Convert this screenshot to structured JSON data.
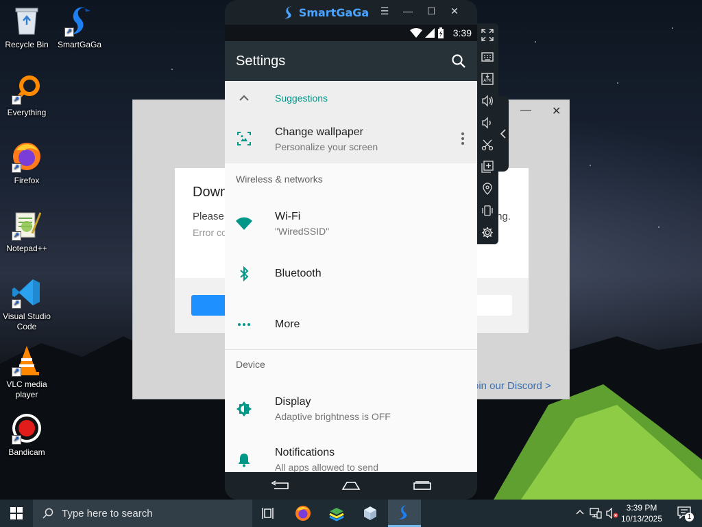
{
  "desktop": {
    "icons": [
      {
        "name": "recycle-bin",
        "label": "Recycle Bin"
      },
      {
        "name": "smartgaga",
        "label": "SmartGaGa"
      },
      {
        "name": "everything",
        "label": "Everything"
      },
      {
        "name": "firefox",
        "label": "Firefox"
      },
      {
        "name": "notepad-plus-plus",
        "label": "Notepad++"
      },
      {
        "name": "visual-studio-code",
        "label": "Visual Studio Code"
      },
      {
        "name": "vlc",
        "label": "VLC media player"
      },
      {
        "name": "bandicam",
        "label": "Bandicam"
      }
    ]
  },
  "background_dialog": {
    "title": "Down",
    "line1": "Please",
    "line1_tail": "ng.",
    "line2": "Error co",
    "discord_link": "oin our Discord >"
  },
  "emulator": {
    "title": "SmartGaGa",
    "controls": {
      "menu": "☰",
      "minimize": "—",
      "maximize": "☐",
      "close": "✕"
    },
    "status_bar": {
      "time": "3:39"
    },
    "app_bar": {
      "title": "Settings"
    },
    "settings": {
      "suggestions_label": "Suggestions",
      "change_wallpaper": {
        "title": "Change wallpaper",
        "subtitle": "Personalize your screen"
      },
      "wireless_section": "Wireless & networks",
      "wifi": {
        "title": "Wi-Fi",
        "subtitle": "\"WiredSSID\""
      },
      "bluetooth": {
        "title": "Bluetooth"
      },
      "more": {
        "title": "More"
      },
      "device_section": "Device",
      "display": {
        "title": "Display",
        "subtitle": "Adaptive brightness is OFF"
      },
      "notifications": {
        "title": "Notifications",
        "subtitle": "All apps allowed to send"
      }
    }
  },
  "taskbar": {
    "search_placeholder": "Type here to search",
    "clock_time": "3:39 PM",
    "clock_date": "10/13/2025",
    "notification_count": "1"
  },
  "colors": {
    "teal_accent": "#009688",
    "appbar": "#263238",
    "taskbar": "#1f2b33",
    "smartgaga_blue": "#4aa3ff"
  }
}
